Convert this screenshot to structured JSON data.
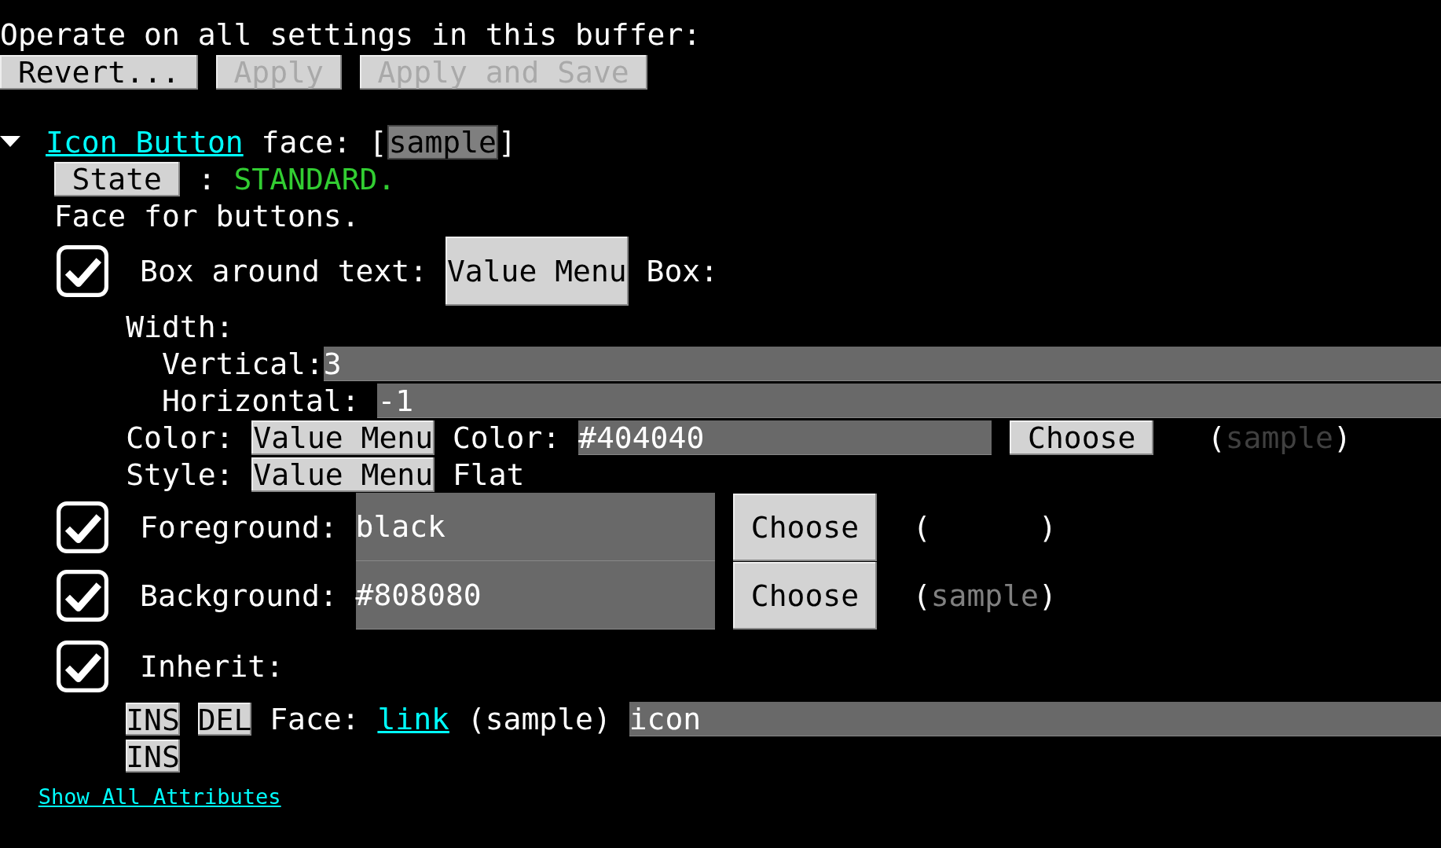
{
  "header": {
    "text": "Operate on all settings in this buffer:"
  },
  "buffer_buttons": [
    {
      "label": "Revert...",
      "disabled": false
    },
    {
      "label": "Apply",
      "disabled": true
    },
    {
      "label": "Apply and Save",
      "disabled": true
    }
  ],
  "face": {
    "expanded": true,
    "name": "Icon Button",
    "label": "face:",
    "bracket_open": "[",
    "sample": "sample",
    "bracket_close": "]",
    "state_button": "State",
    "state_sep": ":",
    "state_text": "STANDARD.",
    "doc": "Face for buttons."
  },
  "attributes": [
    {
      "kind": "box",
      "checked": true,
      "label": "Box around text:",
      "menu": "Value Menu",
      "value_label": "Box:",
      "width_label": "Width:",
      "widths": [
        {
          "label": "Vertical:",
          "value": "3"
        },
        {
          "label": "Horizontal:",
          "value": "-1"
        }
      ],
      "color": {
        "label": "Color:",
        "menu": "Value Menu",
        "value_label": "Color:",
        "value": "#404040",
        "button": "Choose",
        "open": "(",
        "sample": "sample",
        "close": ")"
      },
      "style": {
        "label": "Style:",
        "menu": "Value Menu",
        "value": "Flat"
      }
    },
    {
      "kind": "color",
      "checked": true,
      "label": "Foreground:",
      "value": "black",
      "button": "Choose",
      "open": "(",
      "close": ")"
    },
    {
      "kind": "color",
      "checked": true,
      "label": "Background:",
      "value": "#808080",
      "button": "Choose",
      "open": "(",
      "sample": "sample",
      "close": ")"
    },
    {
      "kind": "inherit",
      "checked": true,
      "label": "Inherit:",
      "entries": [
        {
          "ins": "INS",
          "del": "DEL",
          "label": "Face:",
          "link": "link",
          "sample": "(sample)",
          "value": "icon"
        }
      ],
      "final_ins": "INS"
    }
  ],
  "show_all": "Show All Attributes"
}
